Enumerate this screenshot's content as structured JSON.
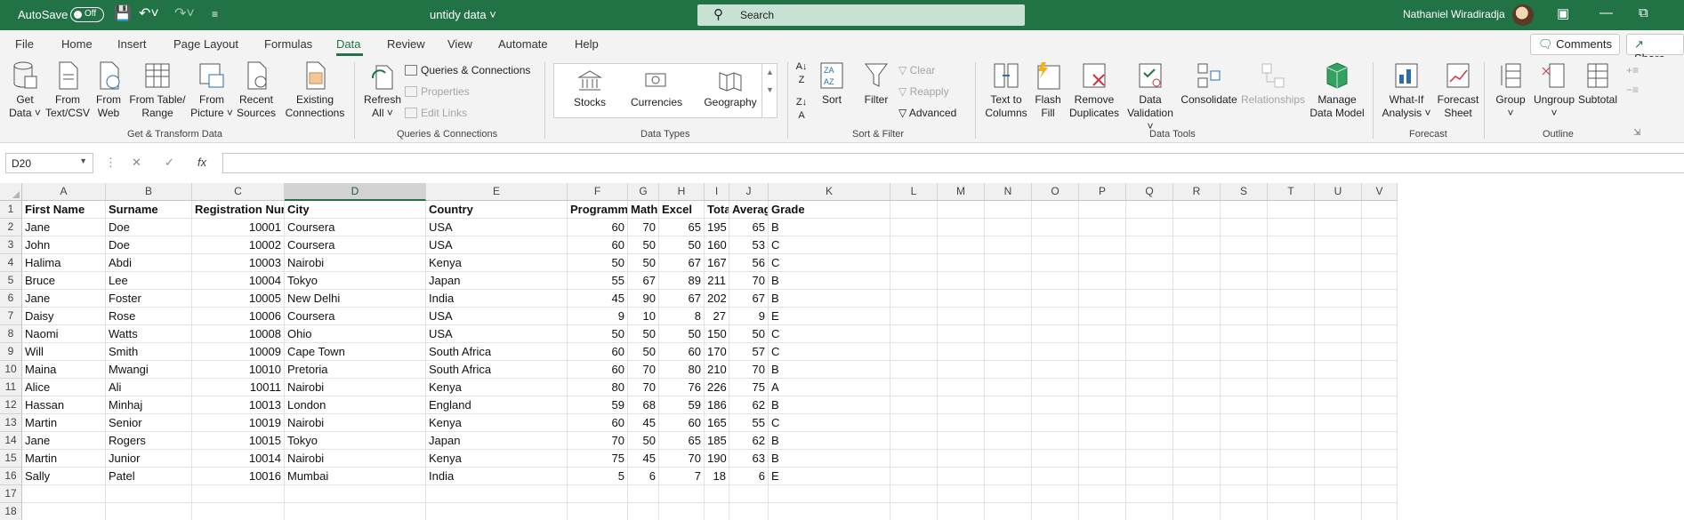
{
  "titlebar": {
    "autosave_label": "AutoSave",
    "autosave_state": "Off",
    "filename": "untidy data",
    "search_placeholder": "Search",
    "user_name": "Nathaniel Wiradiradja"
  },
  "menu": {
    "tabs": [
      "File",
      "Home",
      "Insert",
      "Page Layout",
      "Formulas",
      "Data",
      "Review",
      "View",
      "Automate",
      "Help"
    ],
    "active": "Data",
    "comments_label": "Comments",
    "share_label": "Share"
  },
  "ribbon": {
    "get_transform": {
      "buttons": [
        {
          "line1": "Get",
          "line2": "Data ˅"
        },
        {
          "line1": "From",
          "line2": "Text/CSV"
        },
        {
          "line1": "From",
          "line2": "Web"
        },
        {
          "line1": "From Table/",
          "line2": "Range"
        },
        {
          "line1": "From",
          "line2": "Picture ˅"
        },
        {
          "line1": "Recent",
          "line2": "Sources"
        },
        {
          "line1": "Existing",
          "line2": "Connections"
        }
      ],
      "label": "Get & Transform Data"
    },
    "queries": {
      "refresh_line1": "Refresh",
      "refresh_line2": "All ˅",
      "queries_connections": "Queries & Connections",
      "properties": "Properties",
      "edit_links": "Edit Links",
      "label": "Queries & Connections"
    },
    "data_types": {
      "items": [
        "Stocks",
        "Currencies",
        "Geography"
      ],
      "label": "Data Types"
    },
    "sort_filter": {
      "sort": "Sort",
      "filter": "Filter",
      "clear": "Clear",
      "reapply": "Reapply",
      "advanced": "Advanced",
      "label": "Sort & Filter"
    },
    "data_tools": {
      "buttons": [
        {
          "line1": "Text to",
          "line2": "Columns"
        },
        {
          "line1": "Flash",
          "line2": "Fill"
        },
        {
          "line1": "Remove",
          "line2": "Duplicates"
        },
        {
          "line1": "Data",
          "line2": "Validation ˅"
        },
        {
          "line1": "Consolidate",
          "line2": ""
        },
        {
          "line1": "Relationships",
          "line2": ""
        },
        {
          "line1": "Manage",
          "line2": "Data Model"
        }
      ],
      "label": "Data Tools"
    },
    "forecast": {
      "buttons": [
        {
          "line1": "What-If",
          "line2": "Analysis ˅"
        },
        {
          "line1": "Forecast",
          "line2": "Sheet"
        }
      ],
      "label": "Forecast"
    },
    "outline": {
      "buttons": [
        {
          "line1": "Group",
          "line2": "˅"
        },
        {
          "line1": "Ungroup",
          "line2": "˅"
        },
        {
          "line1": "Subtotal",
          "line2": ""
        }
      ],
      "label": "Outline"
    }
  },
  "formula_bar": {
    "name_box": "D20",
    "fx": "fx",
    "value": ""
  },
  "sheet": {
    "columns": [
      "A",
      "B",
      "C",
      "D",
      "E",
      "F",
      "G",
      "H",
      "I",
      "J",
      "K",
      "L",
      "M",
      "N",
      "O",
      "P",
      "Q",
      "R",
      "S",
      "T",
      "U",
      "V"
    ],
    "selected_column": "D",
    "row_numbers": [
      "1",
      "2",
      "3",
      "4",
      "5",
      "6",
      "7",
      "8",
      "9",
      "10",
      "11",
      "12",
      "13",
      "14",
      "15",
      "16",
      "17",
      "18"
    ],
    "header": [
      "First Name",
      "Surname",
      "Registration Number",
      "City",
      "Country",
      "Programming",
      "Maths",
      "Excel",
      "Total",
      "Average",
      "Grade"
    ],
    "rows": [
      [
        "Jane",
        "Doe",
        "10001",
        "Coursera",
        "USA",
        "60",
        "70",
        "65",
        "195",
        "65",
        "B"
      ],
      [
        "John",
        "Doe",
        "10002",
        "Coursera",
        "USA",
        "60",
        "50",
        "50",
        "160",
        "53",
        "C"
      ],
      [
        "Halima",
        "Abdi",
        "10003",
        "Nairobi",
        "Kenya",
        "50",
        "50",
        "67",
        "167",
        "56",
        "C"
      ],
      [
        "Bruce",
        "Lee",
        "10004",
        "Tokyo",
        "Japan",
        "55",
        "67",
        "89",
        "211",
        "70",
        "B"
      ],
      [
        "Jane",
        "Foster",
        "10005",
        "New Delhi",
        "India",
        "45",
        "90",
        "67",
        "202",
        "67",
        "B"
      ],
      [
        "Daisy",
        "Rose",
        "10006",
        "Coursera",
        "USA",
        "9",
        "10",
        "8",
        "27",
        "9",
        "E"
      ],
      [
        "Naomi",
        "Watts",
        "10008",
        "Ohio",
        "USA",
        "50",
        "50",
        "50",
        "150",
        "50",
        "C"
      ],
      [
        "Will",
        "Smith",
        "10009",
        "Cape Town",
        "South Africa",
        "60",
        "50",
        "60",
        "170",
        "57",
        "C"
      ],
      [
        "Maina",
        "Mwangi",
        "10010",
        "Pretoria",
        "South Africa",
        "60",
        "70",
        "80",
        "210",
        "70",
        "B"
      ],
      [
        "Alice",
        "Ali",
        "10011",
        "Nairobi",
        "Kenya",
        "80",
        "70",
        "76",
        "226",
        "75",
        "A"
      ],
      [
        "Hassan",
        "Minhaj",
        "10013",
        "London",
        "England",
        "59",
        "68",
        "59",
        "186",
        "62",
        "B"
      ],
      [
        "Martin",
        "Senior",
        "10019",
        "Nairobi",
        "Kenya",
        "60",
        "45",
        "60",
        "165",
        "55",
        "C"
      ],
      [
        "Jane",
        "Rogers",
        "10015",
        "Tokyo",
        "Japan",
        "70",
        "50",
        "65",
        "185",
        "62",
        "B"
      ],
      [
        "Martin",
        "Junior",
        "10014",
        "Nairobi",
        "Kenya",
        "75",
        "45",
        "70",
        "190",
        "63",
        "B"
      ],
      [
        "Sally",
        "Patel",
        "10016",
        "Mumbai",
        "India",
        "5",
        "6",
        "7",
        "18",
        "6",
        "E"
      ]
    ]
  }
}
